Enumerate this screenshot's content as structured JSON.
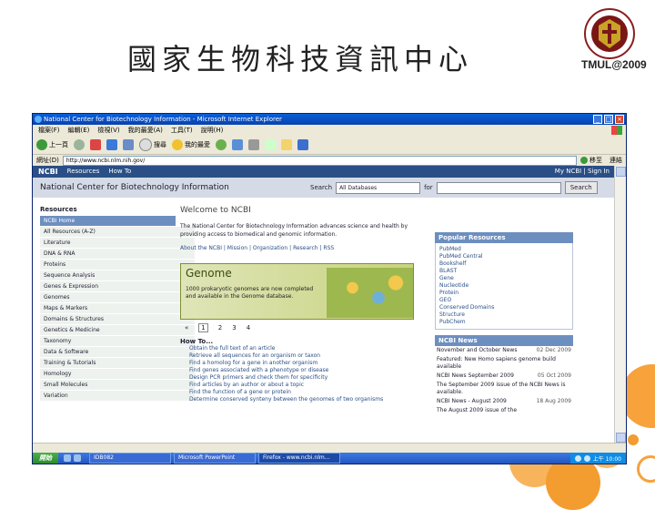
{
  "slide": {
    "title": "國家生物科技資訊中心",
    "logo_caption": "TMUL@2009"
  },
  "browser": {
    "title": "National Center for Biotechnology Information - Microsoft Internet Explorer",
    "menu": [
      "檔案(F)",
      "編輯(E)",
      "檢視(V)",
      "我的最愛(A)",
      "工具(T)",
      "說明(H)"
    ],
    "toolbar": {
      "back": "上一頁",
      "search": "搜尋",
      "favorites": "我的最愛"
    },
    "address_label": "網址(D)",
    "address_value": "http://www.ncbi.nlm.nih.gov/",
    "go_label": "移至",
    "link_label": "連結"
  },
  "ncbi": {
    "brand": "NCBI",
    "top_links": [
      "Resources",
      "How To"
    ],
    "top_right": "My NCBI | Sign In",
    "header_title": "National Center for Biotechnology Information",
    "search_label": "Search",
    "db_value": "All Databases",
    "for_label": "for",
    "search_button": "Search",
    "resources_heading": "Resources",
    "resources": [
      "NCBI Home",
      "All Resources (A-Z)",
      "Literature",
      "DNA & RNA",
      "Proteins",
      "Sequence Analysis",
      "Genes & Expression",
      "Genomes",
      "Maps & Markers",
      "Domains & Structures",
      "Genetics & Medicine",
      "Taxonomy",
      "Data & Software",
      "Training & Tutorials",
      "Homology",
      "Small Molecules",
      "Variation"
    ],
    "welcome_heading": "Welcome to NCBI",
    "welcome_text": "The National Center for Biotechnology Information advances science and health by providing access to biomedical and genomic information.",
    "about_links": "About the NCBI | Mission | Organization | Research | RSS",
    "banner_title": "Genome",
    "banner_text": "1000 prokaryotic genomes are now completed and available in the Genome database.",
    "pager": [
      "«",
      "1",
      "2",
      "3",
      "4"
    ],
    "howto_heading": "How To...",
    "howto": [
      "Obtain the full text of an article",
      "Retrieve all sequences for an organism or taxon",
      "Find a homolog for a gene in another organism",
      "Find genes associated with a phenotype or disease",
      "Design PCR primers and check them for specificity",
      "Find articles by an author or about a topic",
      "Find the function of a gene or protein",
      "Determine conserved synteny between the genomes of two organisms"
    ],
    "popular_heading": "Popular Resources",
    "popular": [
      "PubMed",
      "PubMed Central",
      "Bookshelf",
      "BLAST",
      "Gene",
      "Nucleotide",
      "Protein",
      "GEO",
      "Conserved Domains",
      "Structure",
      "PubChem"
    ],
    "news_heading": "NCBI News",
    "news": [
      {
        "text": "November and October News",
        "date": "02 Dec 2009"
      },
      {
        "text": "Featured: New Homo sapiens genome build available",
        "date": ""
      },
      {
        "text": "NCBI News September 2009",
        "date": "05 Oct 2009"
      },
      {
        "text": "The September 2009 issue of the NCBI News is available.",
        "date": ""
      },
      {
        "text": "NCBI News - August 2009",
        "date": "18 Aug 2009"
      },
      {
        "text": "The August 2009 issue of the",
        "date": ""
      }
    ]
  },
  "taskbar": {
    "start": "開始",
    "tasks": [
      "IDB082",
      "Microsoft PowerPoint",
      "Firefox - www.ncbi.nlm..."
    ],
    "clock": "上午 10:00"
  }
}
